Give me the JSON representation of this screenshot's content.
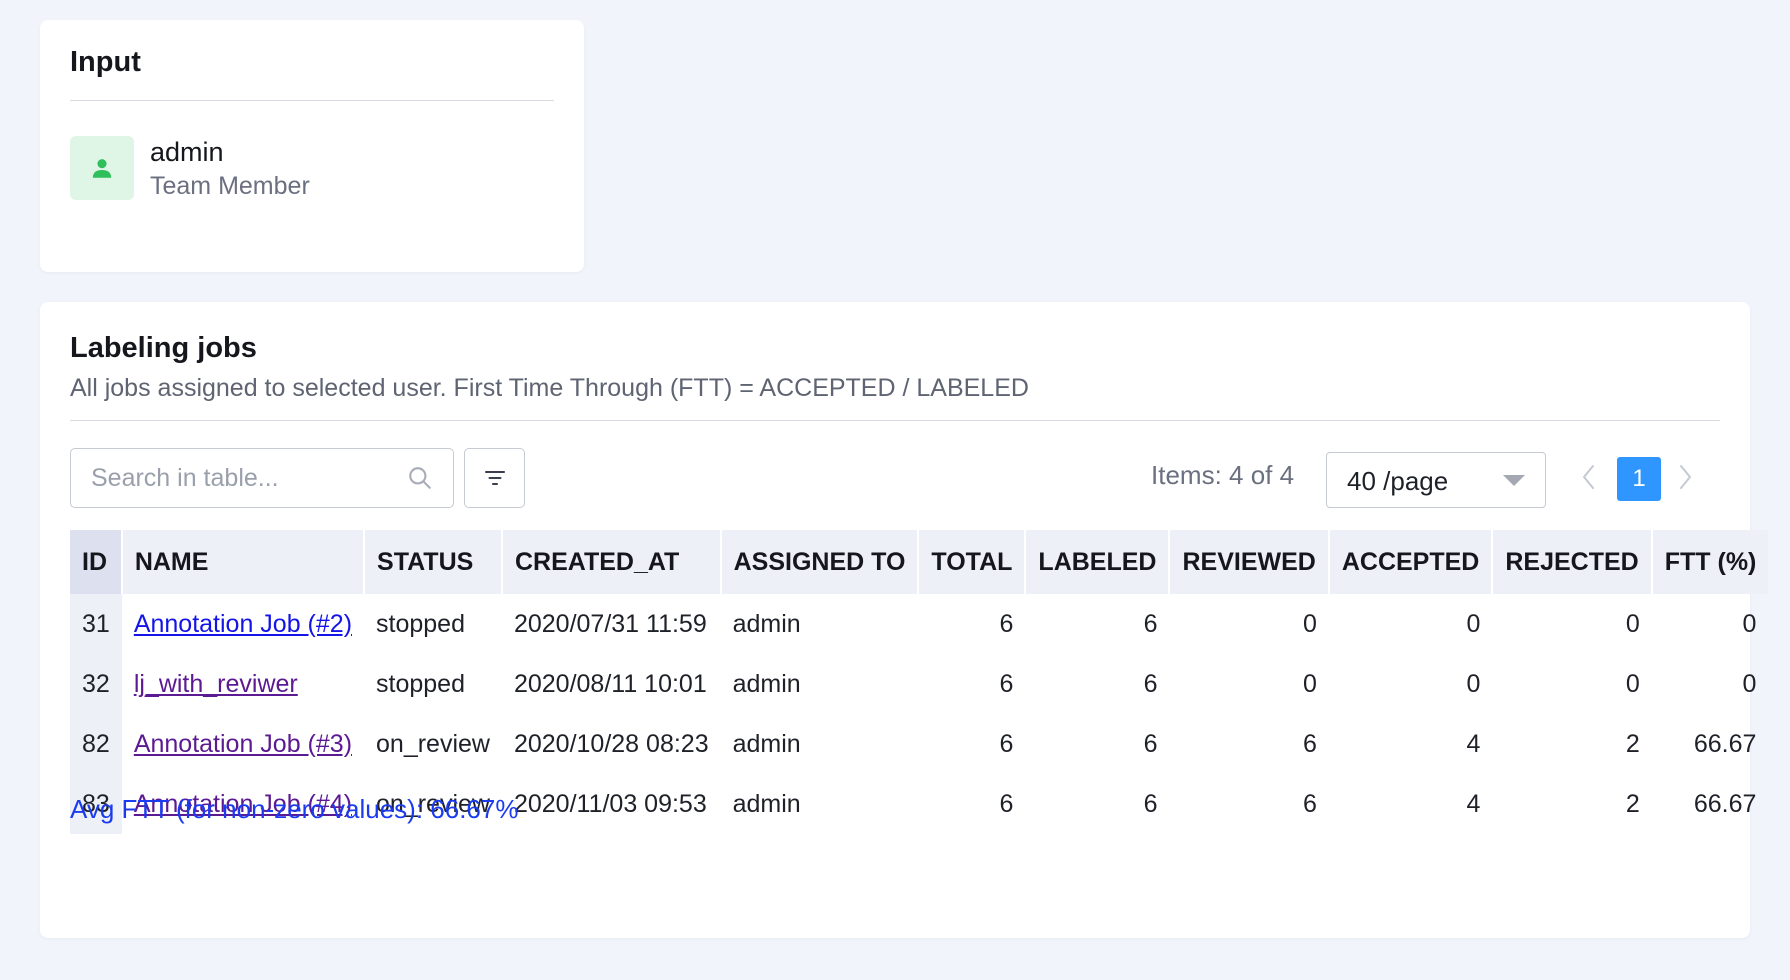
{
  "input_card": {
    "title": "Input",
    "user": {
      "name": "admin",
      "role": "Team Member",
      "avatar_icon": "user-icon"
    }
  },
  "jobs_card": {
    "title": "Labeling jobs",
    "subtitle": "All jobs assigned to selected user. First Time Through (FTT) = ACCEPTED / LABELED",
    "search_placeholder": "Search in table...",
    "items_label": "Items: 4 of 4",
    "page_size": "40 /page",
    "current_page": "1",
    "columns": [
      "ID",
      "NAME",
      "STATUS",
      "CREATED_AT",
      "ASSIGNED TO",
      "TOTAL",
      "LABELED",
      "REVIEWED",
      "ACCEPTED",
      "REJECTED",
      "FTT (%)"
    ],
    "rows": [
      {
        "id": "31",
        "name": "Annotation Job (#2)",
        "status": "stopped",
        "created_at": "2020/07/31 11:59",
        "assigned_to": "admin",
        "total": "6",
        "labeled": "6",
        "reviewed": "0",
        "accepted": "0",
        "rejected": "0",
        "ftt": "0"
      },
      {
        "id": "32",
        "name": "lj_with_reviwer",
        "status": "stopped",
        "created_at": "2020/08/11 10:01",
        "assigned_to": "admin",
        "total": "6",
        "labeled": "6",
        "reviewed": "0",
        "accepted": "0",
        "rejected": "0",
        "ftt": "0"
      },
      {
        "id": "82",
        "name": "Annotation Job (#3)",
        "status": "on_review",
        "created_at": "2020/10/28 08:23",
        "assigned_to": "admin",
        "total": "6",
        "labeled": "6",
        "reviewed": "6",
        "accepted": "4",
        "rejected": "2",
        "ftt": "66.67"
      },
      {
        "id": "83",
        "name": "Annotation Job (#4)",
        "status": "on_review",
        "created_at": "2020/11/03 09:53",
        "assigned_to": "admin",
        "total": "6",
        "labeled": "6",
        "reviewed": "6",
        "accepted": "4",
        "rejected": "2",
        "ftt": "66.67"
      }
    ],
    "avg_ftt": "Avg FTT (for non-zero values): 66.67%"
  },
  "colors": {
    "background": "#f1f4fb",
    "accent": "#2f96ff",
    "avatar_bg": "#dff5e5",
    "avatar_icon": "#2fbf5b",
    "link_blue": "#1414e8",
    "link_visited": "#5c1a92",
    "avg_text": "#1a3bf0"
  }
}
